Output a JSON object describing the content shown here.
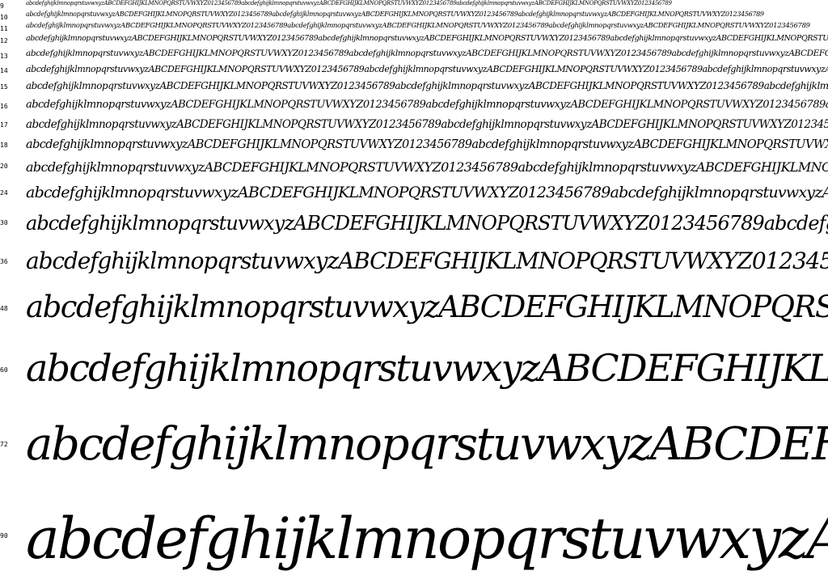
{
  "specimen": {
    "sample_text": "abcdefghijklmnopqrstuvwxyzABCDEFGHIJKLMNOPQRSTUVWXYZ0123456789abcdefghijklmnopqrstuvwxyzABCDEFGHIJKLMNOPQRSTUVWXYZ0123456789abcdefghijklmnopqrstuvwxyzABCDEFGHIJKLMNOPQRSTUVWXYZ0123456789",
    "rows": [
      {
        "size_label": "9"
      },
      {
        "size_label": "10"
      },
      {
        "size_label": "11"
      },
      {
        "size_label": "12"
      },
      {
        "size_label": "13"
      },
      {
        "size_label": "14"
      },
      {
        "size_label": "15"
      },
      {
        "size_label": "16"
      },
      {
        "size_label": "17"
      },
      {
        "size_label": "18"
      },
      {
        "size_label": "20"
      },
      {
        "size_label": "24"
      },
      {
        "size_label": "30"
      },
      {
        "size_label": "36"
      },
      {
        "size_label": "48"
      },
      {
        "size_label": "60"
      },
      {
        "size_label": "72"
      },
      {
        "size_label": "90"
      }
    ]
  }
}
